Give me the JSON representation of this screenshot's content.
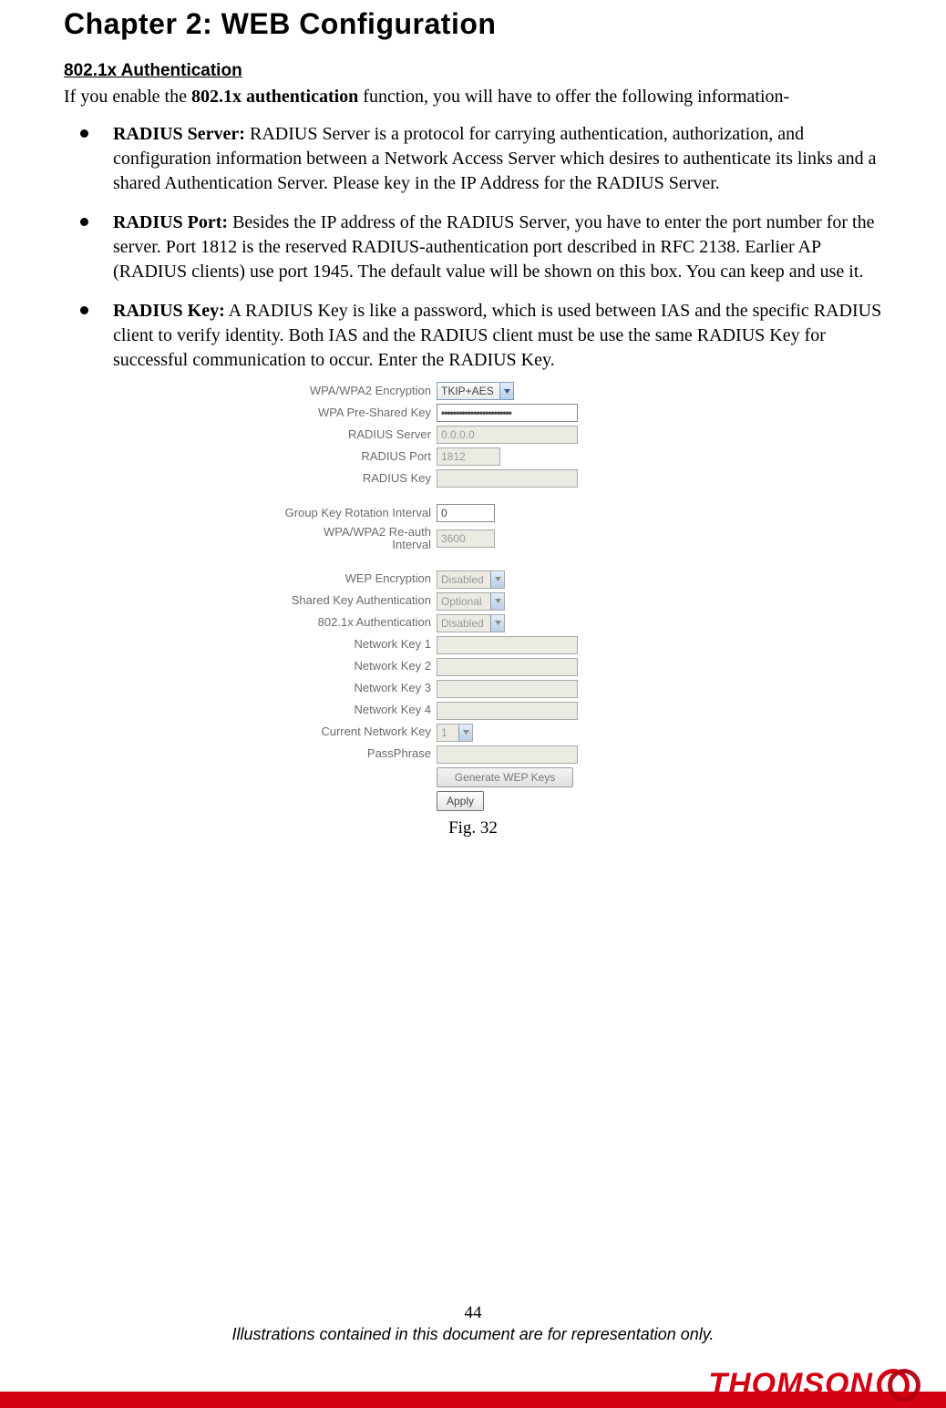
{
  "chapter_title": "Chapter 2: WEB Configuration",
  "subheading": "802.1x Authentication",
  "intro_pre": "If you enable the ",
  "intro_bold": "802.1x authentication",
  "intro_post": " function, you will have to offer the following information-",
  "bullets": [
    {
      "term": "RADIUS Server:",
      "text": " RADIUS Server is a protocol for carrying authentication, authorization, and configuration information between a Network Access Server which desires to authenticate its links and a shared Authentication Server. Please key in the IP Address for the RADIUS Server."
    },
    {
      "term": "RADIUS Port:",
      "text": " Besides the IP address of the RADIUS Server, you have to enter the port number for the server. Port 1812 is the reserved RADIUS-authentication port described in RFC 2138. Earlier AP (RADIUS clients) use port 1945. The default value will be shown on this box. You can keep and use it."
    },
    {
      "term": "RADIUS Key:",
      "text": " A RADIUS Key is like a password, which is used between IAS and the specific RADIUS client to verify identity. Both IAS and the RADIUS client must be use the same RADIUS Key for successful communication to occur. Enter the RADIUS Key."
    }
  ],
  "config": {
    "wpa_enc_label": "WPA/WPA2 Encryption",
    "wpa_enc_value": "TKIP+AES",
    "psk_label": "WPA Pre-Shared Key",
    "psk_value": "••••••••••••••••••••••••",
    "radius_server_label": "RADIUS Server",
    "radius_server_value": "0.0.0.0",
    "radius_port_label": "RADIUS Port",
    "radius_port_value": "1812",
    "radius_key_label": "RADIUS Key",
    "radius_key_value": "",
    "group_key_label": "Group Key Rotation Interval",
    "group_key_value": "0",
    "reauth_label_line1": "WPA/WPA2 Re-auth",
    "reauth_label_line2": "Interval",
    "reauth_value": "3600",
    "wep_enc_label": "WEP Encryption",
    "wep_enc_value": "Disabled",
    "shared_key_label": "Shared Key Authentication",
    "shared_key_value": "Optional",
    "dot1x_label": "802.1x Authentication",
    "dot1x_value": "Disabled",
    "nk1_label": "Network Key 1",
    "nk2_label": "Network Key 2",
    "nk3_label": "Network Key 3",
    "nk4_label": "Network Key 4",
    "cur_key_label": "Current Network Key",
    "cur_key_value": "1",
    "pass_label": "PassPhrase",
    "gen_btn": "Generate WEP Keys",
    "apply_btn": "Apply"
  },
  "figure_caption": "Fig. 32",
  "page_number": "44",
  "footer_note": "Illustrations contained in this document are for representation only.",
  "brand": "THOMSON"
}
